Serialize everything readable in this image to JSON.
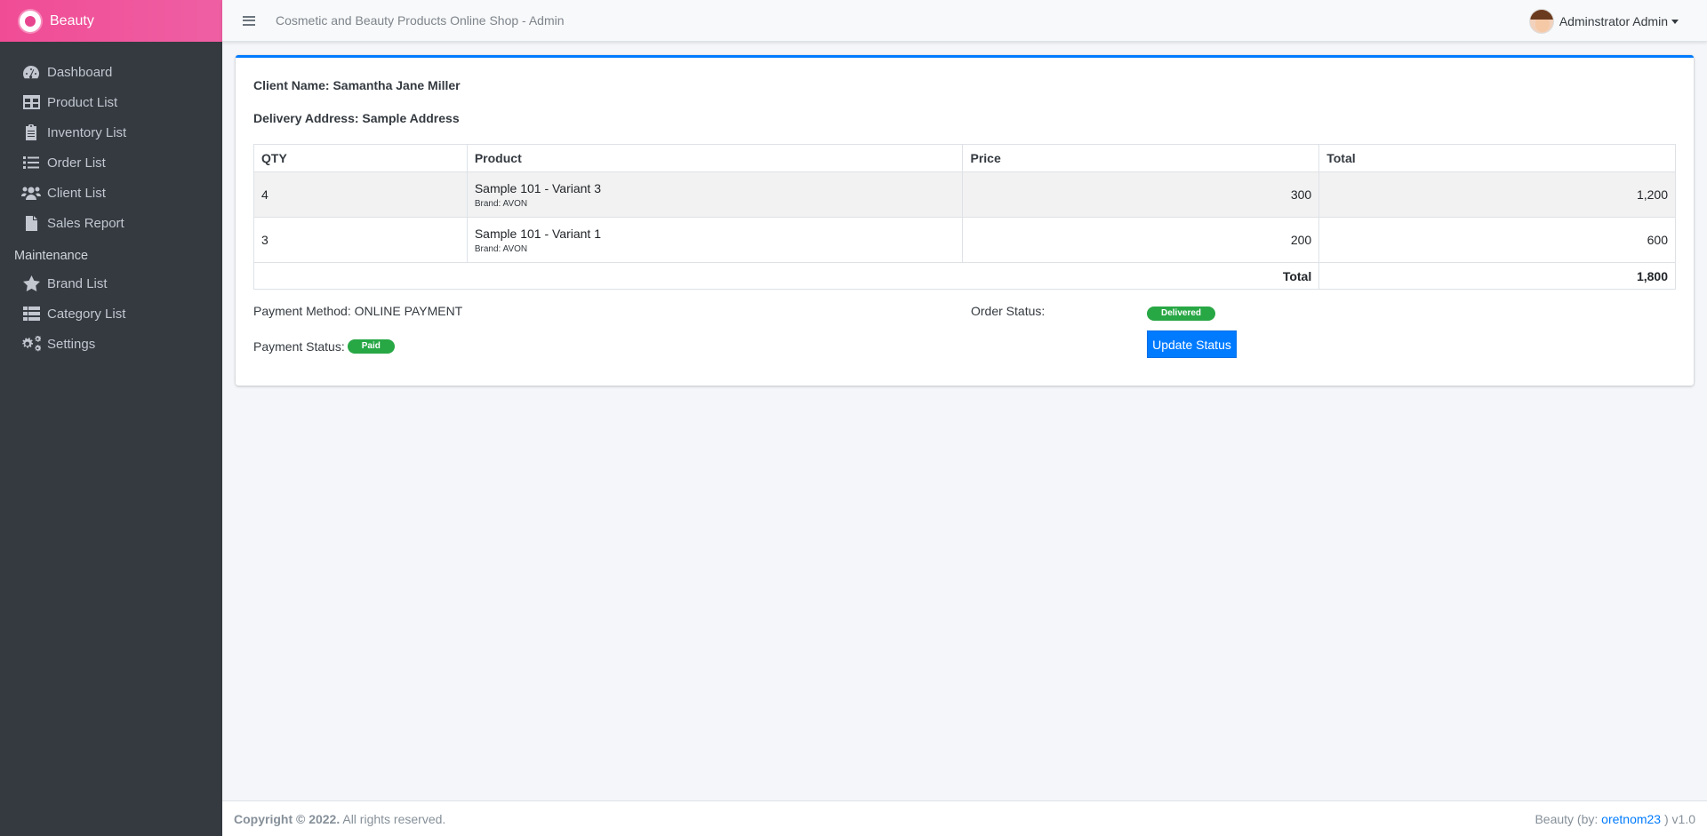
{
  "brand": {
    "name": "Beauty"
  },
  "topbar": {
    "title": "Cosmetic and Beauty Products Online Shop - Admin",
    "user": "Adminstrator Admin"
  },
  "sidebar": {
    "items": [
      {
        "label": "Dashboard",
        "icon": "dashboard-icon"
      },
      {
        "label": "Product List",
        "icon": "table-icon"
      },
      {
        "label": "Inventory List",
        "icon": "clipboard-icon"
      },
      {
        "label": "Order List",
        "icon": "list-icon"
      },
      {
        "label": "Client List",
        "icon": "users-icon"
      },
      {
        "label": "Sales Report",
        "icon": "file-icon"
      }
    ],
    "section_header": "Maintenance",
    "maintenance_items": [
      {
        "label": "Brand List",
        "icon": "star-icon"
      },
      {
        "label": "Category List",
        "icon": "th-list-icon"
      },
      {
        "label": "Settings",
        "icon": "cogs-icon"
      }
    ]
  },
  "order": {
    "client_name": "Client Name: Samantha Jane Miller",
    "delivery_address": "Delivery Address: Sample Address",
    "columns": [
      "QTY",
      "Product",
      "Price",
      "Total"
    ],
    "rows": [
      {
        "qty": "4",
        "product": "Sample 101 - Variant 3",
        "brand": "Brand: AVON",
        "price": "300",
        "total": "1,200"
      },
      {
        "qty": "3",
        "product": "Sample 101 - Variant 1",
        "brand": "Brand: AVON",
        "price": "200",
        "total": "600"
      }
    ],
    "total_label": "Total",
    "grand_total": "1,800",
    "payment_method": "Payment Method: ONLINE PAYMENT",
    "payment_status_label": "Payment Status:",
    "payment_status": "Paid",
    "order_status_label": "Order Status:",
    "order_status": "Delivered",
    "update_button": "Update Status"
  },
  "footer": {
    "copyright": "Copyright © 2022.",
    "rights": " All rights reserved.",
    "credit_prefix": "Beauty (by: ",
    "credit_link": "oretnom23",
    "credit_suffix": " ) v1.0"
  },
  "colors": {
    "brand": "#f04c95",
    "sidebar": "#343a40",
    "primary": "#007bff",
    "success": "#28a745"
  }
}
